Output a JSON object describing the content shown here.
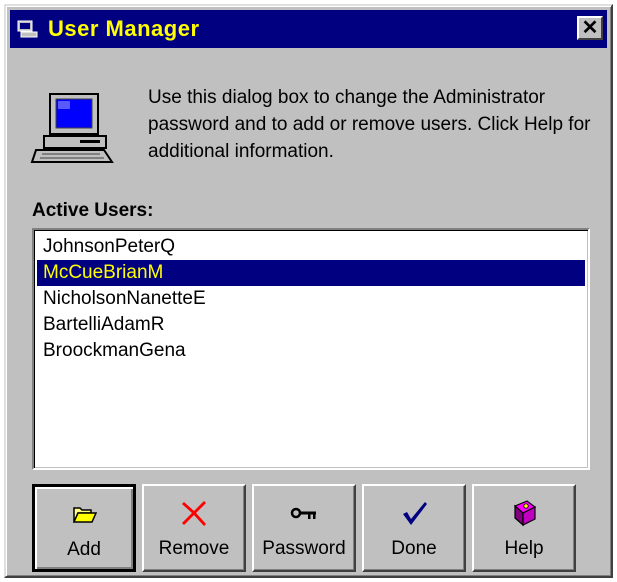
{
  "window": {
    "title": "User Manager",
    "close_glyph": "✕"
  },
  "description": "Use this dialog box to change the Administrator password and to add or remove users. Click Help for additional information.",
  "active_users": {
    "label": "Active Users:",
    "items": [
      {
        "name": "JohnsonPeterQ",
        "selected": false
      },
      {
        "name": "McCueBrianM",
        "selected": true
      },
      {
        "name": "NicholsonNanetteE",
        "selected": false
      },
      {
        "name": "BartelliAdamR",
        "selected": false
      },
      {
        "name": "BroockmanGena",
        "selected": false
      }
    ]
  },
  "buttons": [
    {
      "label": "Add",
      "icon": "folder-open-icon"
    },
    {
      "label": "Remove",
      "icon": "red-x-icon"
    },
    {
      "label": "Password",
      "icon": "key-icon"
    },
    {
      "label": "Done",
      "icon": "checkmark-icon"
    },
    {
      "label": "Help",
      "icon": "help-book-icon"
    }
  ],
  "colors": {
    "title_bar": "#000080",
    "title_text": "#ffff00",
    "dialog_face": "#c0c0c0",
    "selection": "#000080",
    "selection_text": "#ffff00"
  }
}
